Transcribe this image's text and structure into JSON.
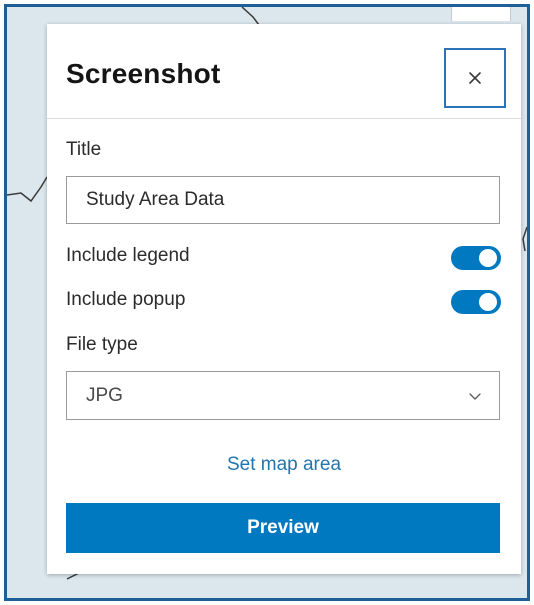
{
  "panel": {
    "title": "Screenshot",
    "close_icon": "close-icon"
  },
  "form": {
    "title_label": "Title",
    "title_value": "Study Area Data",
    "include_legend_label": "Include legend",
    "include_legend_on": true,
    "include_popup_label": "Include popup",
    "include_popup_on": true,
    "file_type_label": "File type",
    "file_type_value": "JPG",
    "file_type_chevron_icon": "chevron-down-icon",
    "set_map_area_label": "Set map area",
    "preview_label": "Preview"
  },
  "colors": {
    "accent": "#0079c1",
    "toggle_on": "#0079c1",
    "map_background": "#dbe6ed",
    "map_frame": "#1f5f97",
    "close_border": "#2b73b8",
    "link": "#2475ad"
  }
}
